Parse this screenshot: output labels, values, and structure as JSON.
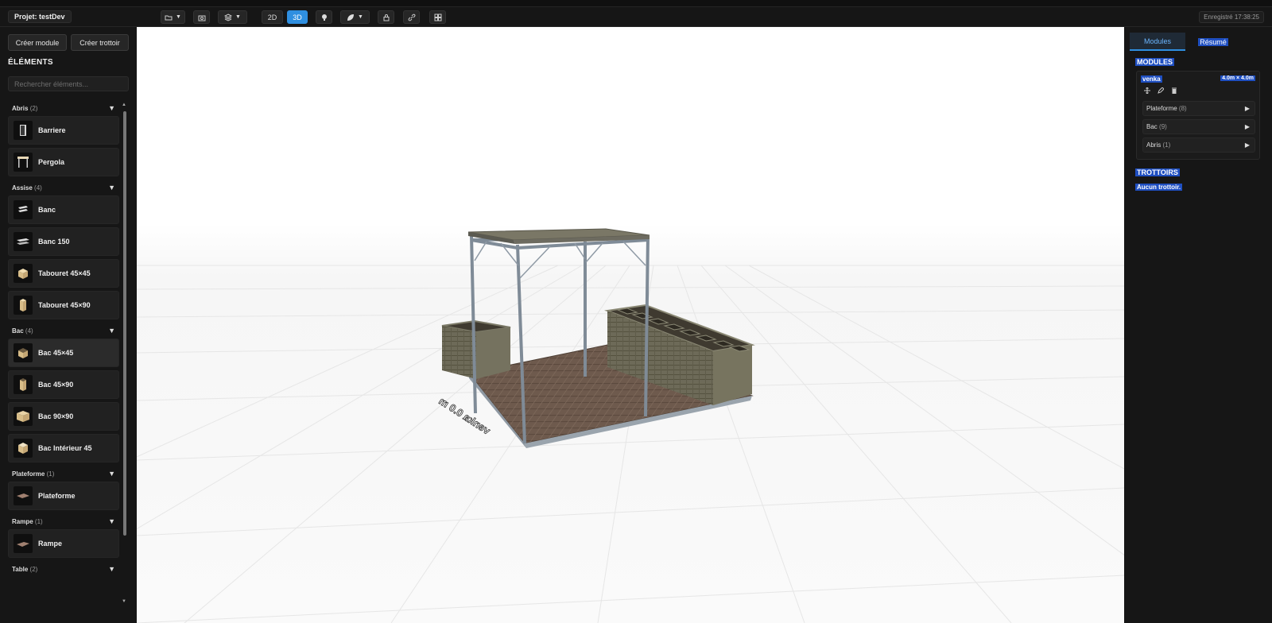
{
  "header": {
    "project_label": "Projet: testDev",
    "view_2d": "2D",
    "view_3d": "3D",
    "saved_status": "Enregistré 17:38:25"
  },
  "left": {
    "create_module": "Créer module",
    "create_sidewalk": "Créer trottoir",
    "title": "ÉLÉMENTS",
    "search_placeholder": "Rechercher éléments...",
    "categories": [
      {
        "name": "Abris",
        "count": "(2)",
        "items": [
          "Barriere",
          "Pergola"
        ]
      },
      {
        "name": "Assise",
        "count": "(4)",
        "items": [
          "Banc",
          "Banc 150",
          "Tabouret 45×45",
          "Tabouret 45×90"
        ]
      },
      {
        "name": "Bac",
        "count": "(4)",
        "items": [
          "Bac 45×45",
          "Bac 45×90",
          "Bac 90×90",
          "Bac Intérieur 45"
        ]
      },
      {
        "name": "Plateforme",
        "count": "(1)",
        "items": [
          "Plateforme"
        ]
      },
      {
        "name": "Rampe",
        "count": "(1)",
        "items": [
          "Rampe"
        ]
      },
      {
        "name": "Table",
        "count": "(2)",
        "items": []
      }
    ]
  },
  "viewport": {
    "module_label": "venka 0.0 m"
  },
  "right": {
    "tab_modules": "Modules",
    "tab_summary": "Résumé",
    "modules_title": "MODULES",
    "module": {
      "name": "venka",
      "dimensions": "4.0m × 4.0m",
      "groups": [
        {
          "name": "Plateforme",
          "count": "(8)"
        },
        {
          "name": "Bac",
          "count": "(9)"
        },
        {
          "name": "Abris",
          "count": "(1)"
        }
      ]
    },
    "sidewalks_title": "TROTTOIRS",
    "no_sidewalk": "Aucun trottoir."
  },
  "colors": {
    "accent": "#2f8fe0",
    "highlight": "#1f4fc1",
    "panel": "#161616",
    "viewport": "#ffffff"
  }
}
